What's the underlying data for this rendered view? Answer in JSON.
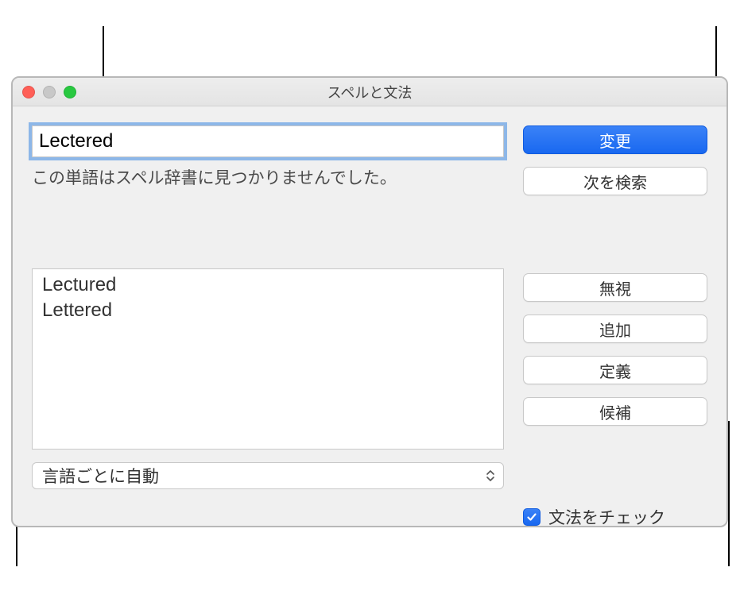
{
  "window": {
    "title": "スペルと文法"
  },
  "input": {
    "value": "Lectered"
  },
  "message": "この単語はスペル辞書に見つかりませんでした。",
  "suggestions": [
    "Lectured",
    "Lettered"
  ],
  "buttons": {
    "change": "変更",
    "find_next": "次を検索",
    "ignore": "無視",
    "learn": "追加",
    "define": "定義",
    "guess": "候補"
  },
  "language_select": {
    "value": "言語ごとに自動"
  },
  "grammar_checkbox": {
    "checked": true,
    "label": "文法をチェック"
  }
}
